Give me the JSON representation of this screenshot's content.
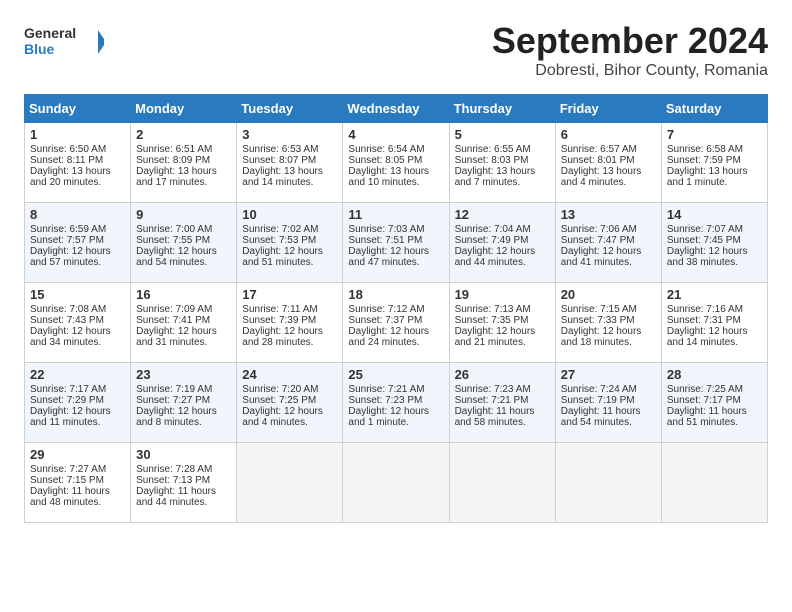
{
  "header": {
    "logo_general": "General",
    "logo_blue": "Blue",
    "month_title": "September 2024",
    "location": "Dobresti, Bihor County, Romania"
  },
  "calendar": {
    "days_of_week": [
      "Sunday",
      "Monday",
      "Tuesday",
      "Wednesday",
      "Thursday",
      "Friday",
      "Saturday"
    ],
    "weeks": [
      [
        {
          "day": "1",
          "lines": [
            "Sunrise: 6:50 AM",
            "Sunset: 8:11 PM",
            "Daylight: 13 hours",
            "and 20 minutes."
          ]
        },
        {
          "day": "2",
          "lines": [
            "Sunrise: 6:51 AM",
            "Sunset: 8:09 PM",
            "Daylight: 13 hours",
            "and 17 minutes."
          ]
        },
        {
          "day": "3",
          "lines": [
            "Sunrise: 6:53 AM",
            "Sunset: 8:07 PM",
            "Daylight: 13 hours",
            "and 14 minutes."
          ]
        },
        {
          "day": "4",
          "lines": [
            "Sunrise: 6:54 AM",
            "Sunset: 8:05 PM",
            "Daylight: 13 hours",
            "and 10 minutes."
          ]
        },
        {
          "day": "5",
          "lines": [
            "Sunrise: 6:55 AM",
            "Sunset: 8:03 PM",
            "Daylight: 13 hours",
            "and 7 minutes."
          ]
        },
        {
          "day": "6",
          "lines": [
            "Sunrise: 6:57 AM",
            "Sunset: 8:01 PM",
            "Daylight: 13 hours",
            "and 4 minutes."
          ]
        },
        {
          "day": "7",
          "lines": [
            "Sunrise: 6:58 AM",
            "Sunset: 7:59 PM",
            "Daylight: 13 hours",
            "and 1 minute."
          ]
        }
      ],
      [
        {
          "day": "8",
          "lines": [
            "Sunrise: 6:59 AM",
            "Sunset: 7:57 PM",
            "Daylight: 12 hours",
            "and 57 minutes."
          ]
        },
        {
          "day": "9",
          "lines": [
            "Sunrise: 7:00 AM",
            "Sunset: 7:55 PM",
            "Daylight: 12 hours",
            "and 54 minutes."
          ]
        },
        {
          "day": "10",
          "lines": [
            "Sunrise: 7:02 AM",
            "Sunset: 7:53 PM",
            "Daylight: 12 hours",
            "and 51 minutes."
          ]
        },
        {
          "day": "11",
          "lines": [
            "Sunrise: 7:03 AM",
            "Sunset: 7:51 PM",
            "Daylight: 12 hours",
            "and 47 minutes."
          ]
        },
        {
          "day": "12",
          "lines": [
            "Sunrise: 7:04 AM",
            "Sunset: 7:49 PM",
            "Daylight: 12 hours",
            "and 44 minutes."
          ]
        },
        {
          "day": "13",
          "lines": [
            "Sunrise: 7:06 AM",
            "Sunset: 7:47 PM",
            "Daylight: 12 hours",
            "and 41 minutes."
          ]
        },
        {
          "day": "14",
          "lines": [
            "Sunrise: 7:07 AM",
            "Sunset: 7:45 PM",
            "Daylight: 12 hours",
            "and 38 minutes."
          ]
        }
      ],
      [
        {
          "day": "15",
          "lines": [
            "Sunrise: 7:08 AM",
            "Sunset: 7:43 PM",
            "Daylight: 12 hours",
            "and 34 minutes."
          ]
        },
        {
          "day": "16",
          "lines": [
            "Sunrise: 7:09 AM",
            "Sunset: 7:41 PM",
            "Daylight: 12 hours",
            "and 31 minutes."
          ]
        },
        {
          "day": "17",
          "lines": [
            "Sunrise: 7:11 AM",
            "Sunset: 7:39 PM",
            "Daylight: 12 hours",
            "and 28 minutes."
          ]
        },
        {
          "day": "18",
          "lines": [
            "Sunrise: 7:12 AM",
            "Sunset: 7:37 PM",
            "Daylight: 12 hours",
            "and 24 minutes."
          ]
        },
        {
          "day": "19",
          "lines": [
            "Sunrise: 7:13 AM",
            "Sunset: 7:35 PM",
            "Daylight: 12 hours",
            "and 21 minutes."
          ]
        },
        {
          "day": "20",
          "lines": [
            "Sunrise: 7:15 AM",
            "Sunset: 7:33 PM",
            "Daylight: 12 hours",
            "and 18 minutes."
          ]
        },
        {
          "day": "21",
          "lines": [
            "Sunrise: 7:16 AM",
            "Sunset: 7:31 PM",
            "Daylight: 12 hours",
            "and 14 minutes."
          ]
        }
      ],
      [
        {
          "day": "22",
          "lines": [
            "Sunrise: 7:17 AM",
            "Sunset: 7:29 PM",
            "Daylight: 12 hours",
            "and 11 minutes."
          ]
        },
        {
          "day": "23",
          "lines": [
            "Sunrise: 7:19 AM",
            "Sunset: 7:27 PM",
            "Daylight: 12 hours",
            "and 8 minutes."
          ]
        },
        {
          "day": "24",
          "lines": [
            "Sunrise: 7:20 AM",
            "Sunset: 7:25 PM",
            "Daylight: 12 hours",
            "and 4 minutes."
          ]
        },
        {
          "day": "25",
          "lines": [
            "Sunrise: 7:21 AM",
            "Sunset: 7:23 PM",
            "Daylight: 12 hours",
            "and 1 minute."
          ]
        },
        {
          "day": "26",
          "lines": [
            "Sunrise: 7:23 AM",
            "Sunset: 7:21 PM",
            "Daylight: 11 hours",
            "and 58 minutes."
          ]
        },
        {
          "day": "27",
          "lines": [
            "Sunrise: 7:24 AM",
            "Sunset: 7:19 PM",
            "Daylight: 11 hours",
            "and 54 minutes."
          ]
        },
        {
          "day": "28",
          "lines": [
            "Sunrise: 7:25 AM",
            "Sunset: 7:17 PM",
            "Daylight: 11 hours",
            "and 51 minutes."
          ]
        }
      ],
      [
        {
          "day": "29",
          "lines": [
            "Sunrise: 7:27 AM",
            "Sunset: 7:15 PM",
            "Daylight: 11 hours",
            "and 48 minutes."
          ]
        },
        {
          "day": "30",
          "lines": [
            "Sunrise: 7:28 AM",
            "Sunset: 7:13 PM",
            "Daylight: 11 hours",
            "and 44 minutes."
          ]
        },
        {
          "day": "",
          "lines": []
        },
        {
          "day": "",
          "lines": []
        },
        {
          "day": "",
          "lines": []
        },
        {
          "day": "",
          "lines": []
        },
        {
          "day": "",
          "lines": []
        }
      ]
    ]
  }
}
